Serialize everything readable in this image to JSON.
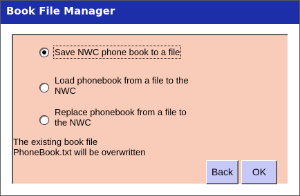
{
  "window": {
    "title": "Book File Manager",
    "title_color": "#1d2fa8",
    "panel_color": "#f9cbb9",
    "button_color": "#c6c8f8"
  },
  "options": [
    {
      "label": "Save NWC phone book to a file",
      "selected": true
    },
    {
      "label_line1": "Load phonebook from a file to the",
      "label_line2": "NWC",
      "selected": false
    },
    {
      "label_line1": "Replace phonebook from a file to",
      "label_line2": "the NWC",
      "selected": false
    }
  ],
  "info": {
    "line1": "The existing book file",
    "line2": "PhoneBook.txt will be overwritten"
  },
  "buttons": {
    "back_label": "Back",
    "ok_label": "OK"
  }
}
